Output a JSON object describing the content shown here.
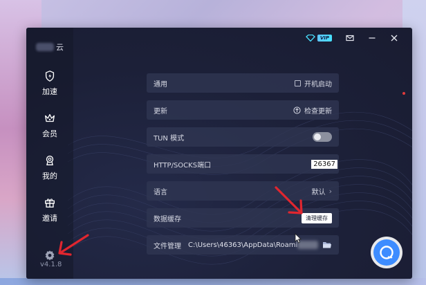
{
  "app": {
    "brand_suffix": "云",
    "version": "v4.1.8",
    "vip_label": "VIP"
  },
  "sidebar": {
    "items": [
      {
        "label": "加速",
        "icon": "shield-bolt-icon"
      },
      {
        "label": "会员",
        "icon": "crown-icon"
      },
      {
        "label": "我的",
        "icon": "user-badge-icon"
      },
      {
        "label": "邀请",
        "icon": "gift-icon"
      }
    ]
  },
  "settings": {
    "general": {
      "label": "通用",
      "option": "开机启动",
      "checked": false
    },
    "update": {
      "label": "更新",
      "action": "检查更新"
    },
    "tun": {
      "label": "TUN 模式",
      "enabled": false
    },
    "port": {
      "label": "HTTP/SOCKS端口",
      "value": "26367"
    },
    "language": {
      "label": "语言",
      "value": "默认"
    },
    "cache": {
      "label": "数据缓存",
      "button": "清理缓存"
    },
    "files": {
      "label": "文件管理",
      "path": "C:\\Users\\46363\\AppData\\Roaming"
    }
  },
  "colors": {
    "window_bg": "#1c2038",
    "row_bg": "#303652",
    "accent_vip": "#48e1ff",
    "annotation_arrow": "#e0262f",
    "float_button": "#3d8cff"
  }
}
